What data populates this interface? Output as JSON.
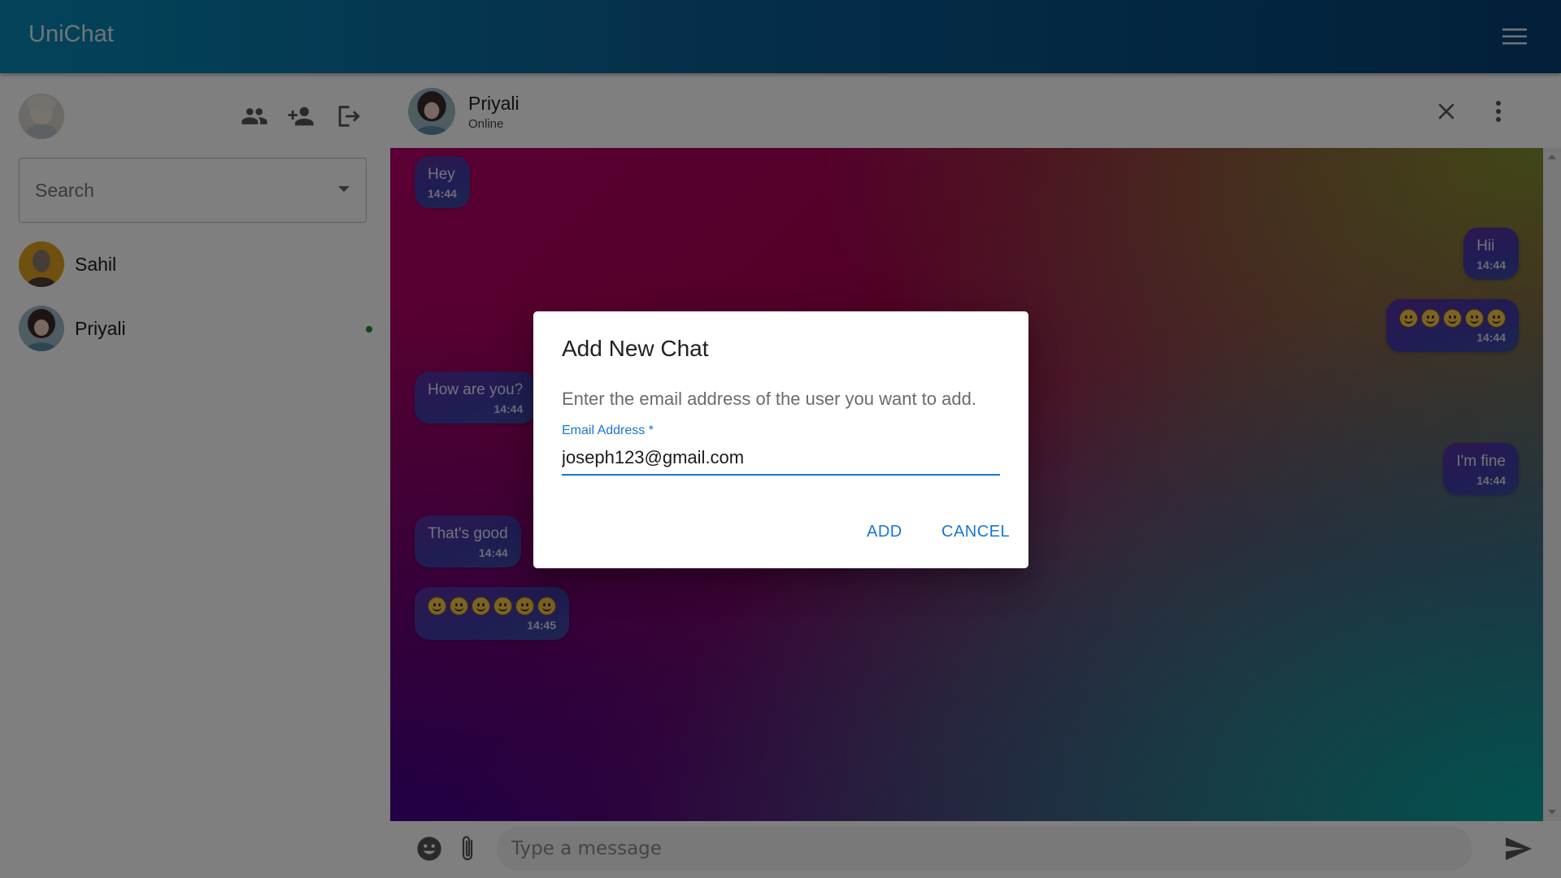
{
  "app": {
    "title": "UniChat"
  },
  "sidebar": {
    "search_placeholder": "Search",
    "contacts": [
      {
        "name": "Sahil",
        "online": false
      },
      {
        "name": "Priyali",
        "online": true
      }
    ]
  },
  "chat": {
    "contact_name": "Priyali",
    "status": "Online",
    "messages": [
      {
        "side": "incoming",
        "text": "Hey",
        "time": "14:44"
      },
      {
        "side": "outgoing",
        "text": "Hii",
        "time": "14:44"
      },
      {
        "side": "outgoing",
        "emoji_count": 5,
        "time": "14:44"
      },
      {
        "side": "incoming",
        "text": "How are you?",
        "time": "14:44"
      },
      {
        "side": "outgoing",
        "text": "I'm fine",
        "time": "14:44"
      },
      {
        "side": "incoming",
        "text": "That's good",
        "time": "14:44"
      },
      {
        "side": "incoming",
        "emoji_count": 6,
        "time": "14:45"
      }
    ],
    "input_placeholder": "Type a message"
  },
  "dialog": {
    "title": "Add New Chat",
    "description": "Enter the email address of the user you want to add.",
    "email_label": "Email Address *",
    "email_value": "joseph123@gmail.com",
    "add_label": "ADD",
    "cancel_label": "CANCEL"
  },
  "colors": {
    "primary": "#1976d2",
    "appbar_start": "#0988b5",
    "appbar_end": "#053f73",
    "online": "#1e8c2f"
  },
  "icons": [
    "menu-icon",
    "group-icon",
    "add-user-icon",
    "logout-icon",
    "dropdown-arrow-icon",
    "close-icon",
    "more-vert-icon",
    "emoji-icon",
    "attach-icon",
    "send-icon"
  ]
}
